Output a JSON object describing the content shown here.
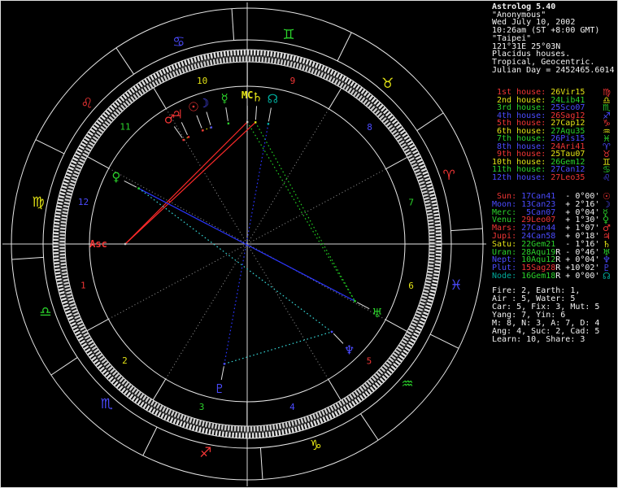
{
  "palette": {
    "red": "#f23535",
    "yellow": "#e3e315",
    "green": "#2bd32b",
    "blue": "#4b4bff",
    "teal": "#00ab9b",
    "cyan": "#3ad8d8",
    "white": "#f2f2f2",
    "gray": "#c2c2c2",
    "dotgray": "#9a9a9a",
    "line": "#e8e8e8",
    "aspect_red": "#ff2a2a",
    "aspect_blue": "#2a35ff",
    "aspect_green": "#22cc22",
    "aspect_yellow": "#d8d800",
    "aspect_cyan": "#35d5d5"
  },
  "header": {
    "lines": [
      "Astrolog 5.40",
      "\"Anonymous\"",
      "Wed July 10, 2002",
      "10:26am (ST +8:00 GMT)",
      "\"Taipei\"",
      "121°31E 25°03N",
      "Placidus houses.",
      "Tropical, Geocentric.",
      "Julian Day = 2452465.6014"
    ]
  },
  "houses": {
    "rows": [
      {
        "label": " 1st house:",
        "value": "26Vir15",
        "label_color": "red",
        "value_color": "yellow",
        "glyph": "♍",
        "glyph_color": "red",
        "cusp_deg": 176.25
      },
      {
        "label": " 2nd house:",
        "value": "24Lib41",
        "label_color": "yellow",
        "value_color": "green",
        "glyph": "♎",
        "glyph_color": "yellow",
        "cusp_deg": 204.683
      },
      {
        "label": " 3rd house:",
        "value": "25Sco07",
        "label_color": "green",
        "value_color": "blue",
        "glyph": "♏",
        "glyph_color": "green",
        "cusp_deg": 235.117
      },
      {
        "label": " 4th house:",
        "value": "26Sag12",
        "label_color": "blue",
        "value_color": "red",
        "glyph": "♐",
        "glyph_color": "blue",
        "cusp_deg": 266.2
      },
      {
        "label": " 5th house:",
        "value": "27Cap12",
        "label_color": "red",
        "value_color": "yellow",
        "glyph": "♑",
        "glyph_color": "red",
        "cusp_deg": 297.2
      },
      {
        "label": " 6th house:",
        "value": "27Aqu35",
        "label_color": "yellow",
        "value_color": "green",
        "glyph": "♒",
        "glyph_color": "yellow",
        "cusp_deg": 327.583
      },
      {
        "label": " 7th house:",
        "value": "26Pis15",
        "label_color": "green",
        "value_color": "blue",
        "glyph": "♓",
        "glyph_color": "green",
        "cusp_deg": 356.25
      },
      {
        "label": " 8th house:",
        "value": "24Ari41",
        "label_color": "blue",
        "value_color": "red",
        "glyph": "♈",
        "glyph_color": "blue",
        "cusp_deg": 24.683
      },
      {
        "label": " 9th house:",
        "value": "25Tau07",
        "label_color": "red",
        "value_color": "yellow",
        "glyph": "♉",
        "glyph_color": "red",
        "cusp_deg": 55.117
      },
      {
        "label": "10th house:",
        "value": "26Gem12",
        "label_color": "yellow",
        "value_color": "green",
        "glyph": "♊",
        "glyph_color": "yellow",
        "cusp_deg": 86.2
      },
      {
        "label": "11th house:",
        "value": "27Can12",
        "label_color": "green",
        "value_color": "blue",
        "glyph": "♋",
        "glyph_color": "green",
        "cusp_deg": 117.2
      },
      {
        "label": "12th house:",
        "value": "27Leo35",
        "label_color": "blue",
        "value_color": "red",
        "glyph": "♌",
        "glyph_color": "blue",
        "cusp_deg": 147.583
      }
    ]
  },
  "planets": {
    "rows": [
      {
        "name": "Sun",
        "label": " Sun:",
        "value": "17Can41",
        "retro": " ",
        "velocity": "- 0°00'",
        "label_color": "red",
        "value_color": "blue",
        "glyph": "☉",
        "glyph_color": "red",
        "lon_deg": 107.683
      },
      {
        "name": "Moon",
        "label": "Moon:",
        "value": "13Can23",
        "retro": " ",
        "velocity": "+ 2°16'",
        "label_color": "blue",
        "value_color": "blue",
        "glyph": "☽",
        "glyph_color": "blue",
        "lon_deg": 103.383
      },
      {
        "name": "Merc",
        "label": "Merc:",
        "value": " 5Can07",
        "retro": " ",
        "velocity": "+ 0°04'",
        "label_color": "green",
        "value_color": "blue",
        "glyph": "☿",
        "glyph_color": "green",
        "lon_deg": 95.117
      },
      {
        "name": "Venu",
        "label": "Venu:",
        "value": "29Leo07",
        "retro": " ",
        "velocity": "+ 1°30'",
        "label_color": "green",
        "value_color": "red",
        "glyph": "♀",
        "glyph_color": "green",
        "lon_deg": 149.117
      },
      {
        "name": "Mars",
        "label": "Mars:",
        "value": "27Can44",
        "retro": " ",
        "velocity": "+ 1°07'",
        "label_color": "red",
        "value_color": "blue",
        "glyph": "♂",
        "glyph_color": "red",
        "lon_deg": 117.733
      },
      {
        "name": "Jupi",
        "label": "Jupi:",
        "value": "24Can58",
        "retro": " ",
        "velocity": "+ 0°18'",
        "label_color": "red",
        "value_color": "blue",
        "glyph": "♃",
        "glyph_color": "red",
        "lon_deg": 114.967
      },
      {
        "name": "Satu",
        "label": "Satu:",
        "value": "22Gem21",
        "retro": " ",
        "velocity": "- 1°16'",
        "label_color": "yellow",
        "value_color": "green",
        "glyph": "♄",
        "glyph_color": "yellow",
        "lon_deg": 82.35
      },
      {
        "name": "Uran",
        "label": "Uran:",
        "value": "28Aqu19",
        "retro": "R",
        "velocity": "- 0°46'",
        "label_color": "green",
        "value_color": "green",
        "glyph": "♅",
        "glyph_color": "green",
        "lon_deg": 328.317
      },
      {
        "name": "Nept",
        "label": "Nept:",
        "value": "10Aqu12",
        "retro": "R",
        "velocity": "+ 0°04'",
        "label_color": "blue",
        "value_color": "green",
        "glyph": "♆",
        "glyph_color": "blue",
        "lon_deg": 310.2
      },
      {
        "name": "Plut",
        "label": "Plut:",
        "value": "15Sag28",
        "retro": "R",
        "velocity": "+10°02'",
        "label_color": "blue",
        "value_color": "red",
        "glyph": "♇",
        "glyph_color": "blue",
        "lon_deg": 255.467
      },
      {
        "name": "Node",
        "label": "Node:",
        "value": "16Gem18",
        "retro": "R",
        "velocity": "+ 0°00'",
        "label_color": "teal",
        "value_color": "green",
        "glyph": "☊",
        "glyph_color": "teal",
        "lon_deg": 76.3
      }
    ]
  },
  "stats": {
    "lines": [
      "Fire: 2, Earth: 1,",
      "Air : 5, Water: 5",
      "Car: 5, Fix: 3, Mut: 5",
      "Yang: 7, Yin: 6",
      "M: 8, N: 3, A: 7, D: 4",
      "Ang: 4, Suc: 2, Cad: 5",
      "Learn: 10, Share: 3"
    ]
  },
  "wheel": {
    "asc_label": "Asc",
    "mc_label": "MC",
    "asc_deg": 176.25,
    "mc_deg": 86.2,
    "signs": [
      {
        "name": "Aries",
        "glyph": "♈",
        "color": "red"
      },
      {
        "name": "Taurus",
        "glyph": "♉",
        "color": "yellow"
      },
      {
        "name": "Gemini",
        "glyph": "♊",
        "color": "green"
      },
      {
        "name": "Cancer",
        "glyph": "♋",
        "color": "blue"
      },
      {
        "name": "Leo",
        "glyph": "♌",
        "color": "red"
      },
      {
        "name": "Virgo",
        "glyph": "♍",
        "color": "yellow"
      },
      {
        "name": "Libra",
        "glyph": "♎",
        "color": "green"
      },
      {
        "name": "Scorpio",
        "glyph": "♏",
        "color": "blue"
      },
      {
        "name": "Sagittarius",
        "glyph": "♐",
        "color": "red"
      },
      {
        "name": "Capricorn",
        "glyph": "♑",
        "color": "yellow"
      },
      {
        "name": "Aquarius",
        "glyph": "♒",
        "color": "green"
      },
      {
        "name": "Pisces",
        "glyph": "♓",
        "color": "blue"
      }
    ],
    "house_number_colors": [
      "red",
      "yellow",
      "green",
      "blue",
      "red",
      "yellow",
      "green",
      "blue",
      "red",
      "yellow",
      "green",
      "blue"
    ],
    "aspects": [
      {
        "from": "Asc",
        "to": "MC",
        "color": "aspect_red",
        "style": "solid"
      },
      {
        "from": "Asc",
        "to": "Satu",
        "color": "aspect_red",
        "style": "solid"
      },
      {
        "from": "Venu",
        "to": "Uran",
        "color": "aspect_blue",
        "style": "solid"
      },
      {
        "from": "MC",
        "to": "Uran",
        "color": "aspect_green",
        "style": "dotted"
      },
      {
        "from": "Satu",
        "to": "Uran",
        "color": "aspect_green",
        "style": "dotted"
      },
      {
        "from": "Node",
        "to": "Plut",
        "color": "aspect_blue",
        "style": "dotted"
      },
      {
        "from": "Plut",
        "to": "Nept",
        "color": "aspect_cyan",
        "style": "dotted"
      },
      {
        "from": "Venu",
        "to": "Nept",
        "color": "aspect_cyan",
        "style": "dotted"
      },
      {
        "from": "Sun",
        "to": "Moon",
        "color": "aspect_yellow",
        "style": "dotted"
      },
      {
        "from": "Mars",
        "to": "Jupi",
        "color": "aspect_yellow",
        "style": "dotted"
      }
    ]
  }
}
